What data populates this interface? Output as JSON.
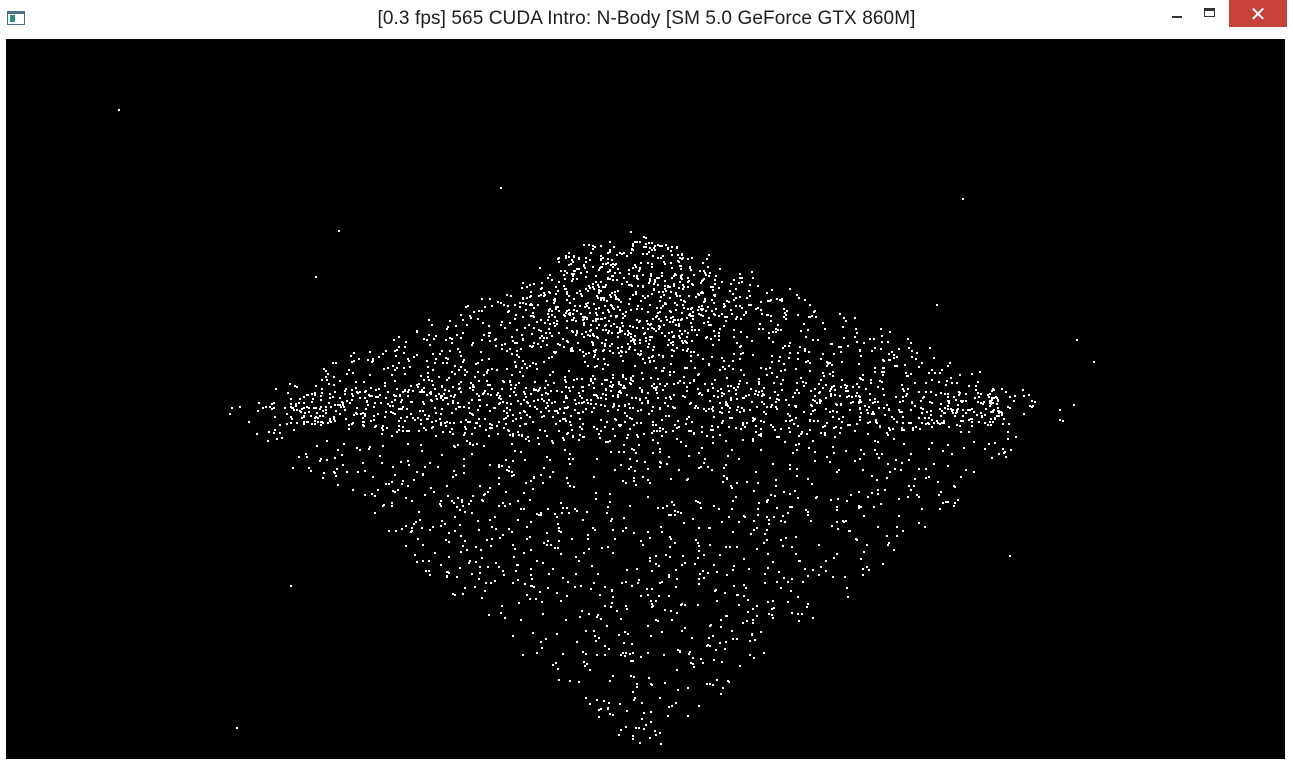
{
  "window": {
    "title": "[0.3 fps] 565 CUDA Intro: N-Body [SM 5.0 GeForce GTX 860M]",
    "close_glyph": "✕"
  },
  "icons": {
    "app": "app-window-icon",
    "minimize": "minimize-icon",
    "maximize": "maximize-icon",
    "close": "close-icon"
  },
  "colors": {
    "titlebar_bg": "#ffffff",
    "close_button": "#c7403a",
    "viewport_bg": "#000000",
    "particle": "#ffffff"
  },
  "simulation": {
    "fps": 0.3,
    "description_visible": false
  }
}
